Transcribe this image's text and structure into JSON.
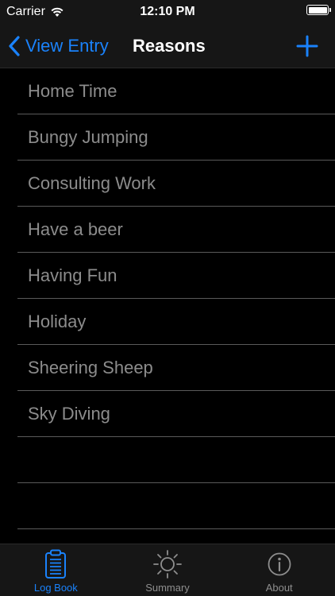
{
  "status_bar": {
    "carrier": "Carrier",
    "time": "12:10 PM"
  },
  "nav": {
    "back_label": "View Entry",
    "title": "Reasons"
  },
  "reasons": [
    "Home Time",
    "Bungy Jumping",
    "Consulting Work",
    "Have a beer",
    "Having Fun",
    "Holiday",
    "Sheering Sheep",
    "Sky Diving"
  ],
  "tabs": [
    {
      "label": "Log Book",
      "icon": "clipboard-icon",
      "active": true
    },
    {
      "label": "Summary",
      "icon": "sun-icon",
      "active": false
    },
    {
      "label": "About",
      "icon": "info-icon",
      "active": false
    }
  ],
  "colors": {
    "accent": "#1a82fb",
    "background": "#000000",
    "bar": "#161616",
    "row_text": "#8c8c8c"
  }
}
